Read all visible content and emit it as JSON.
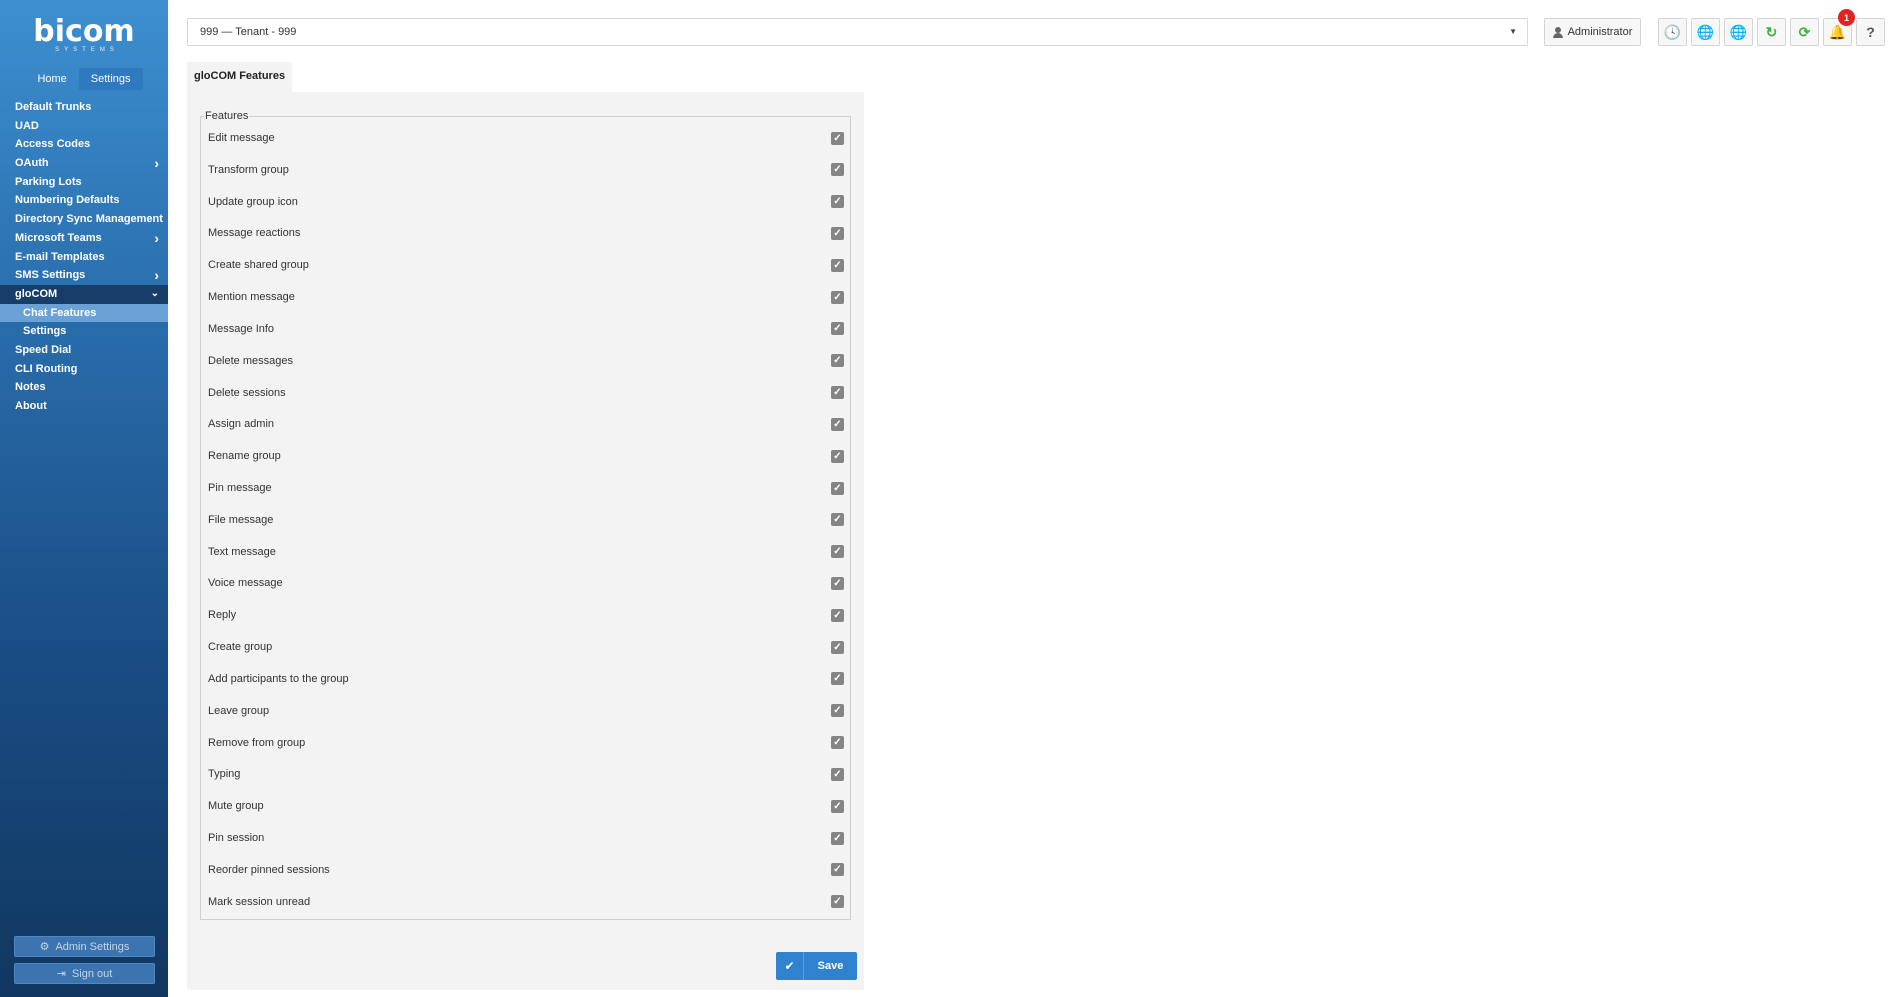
{
  "brand": {
    "name": "bicom",
    "tagline": "SYSTEMS"
  },
  "sidebar": {
    "tabs": [
      {
        "label": "Home",
        "active": false
      },
      {
        "label": "Settings",
        "active": true
      }
    ],
    "items": [
      {
        "label": "Default Trunks"
      },
      {
        "label": "UAD"
      },
      {
        "label": "Access Codes"
      },
      {
        "label": "OAuth",
        "chevron": "chevron-right-icon"
      },
      {
        "label": "Parking Lots"
      },
      {
        "label": "Numbering Defaults"
      },
      {
        "label": "Directory Sync Management"
      },
      {
        "label": "Microsoft Teams",
        "chevron": "chevron-right-icon"
      },
      {
        "label": "E-mail Templates"
      },
      {
        "label": "SMS Settings",
        "chevron": "chevron-right-icon"
      },
      {
        "label": "gloCOM",
        "chevron": "chevron-down-icon",
        "state": "open"
      },
      {
        "label": "Chat Features",
        "sub": true,
        "state": "active"
      },
      {
        "label": "Settings",
        "sub": true
      },
      {
        "label": "Speed Dial"
      },
      {
        "label": "CLI Routing"
      },
      {
        "label": "Notes"
      },
      {
        "label": "About"
      }
    ],
    "admin_settings_label": "Admin Settings",
    "sign_out_label": "Sign out"
  },
  "header": {
    "tenant_value": "999  —  Tenant - 999",
    "user_label": "Administrator",
    "icons": [
      "clock-icon",
      "globe-icon",
      "language-globe-icon",
      "reload-icon",
      "sync-icon",
      "bell-icon",
      "help-icon"
    ],
    "notification_count": "1"
  },
  "main": {
    "tab_label": "gloCOM Features",
    "fieldset_legend": "Features",
    "features": [
      {
        "label": "Edit message",
        "checked": true
      },
      {
        "label": "Transform group",
        "checked": true
      },
      {
        "label": "Update group icon",
        "checked": true
      },
      {
        "label": "Message reactions",
        "checked": true
      },
      {
        "label": "Create shared group",
        "checked": true
      },
      {
        "label": "Mention message",
        "checked": true
      },
      {
        "label": "Message Info",
        "checked": true
      },
      {
        "label": "Delete messages",
        "checked": true
      },
      {
        "label": "Delete sessions",
        "checked": true
      },
      {
        "label": "Assign admin",
        "checked": true
      },
      {
        "label": "Rename group",
        "checked": true
      },
      {
        "label": "Pin message",
        "checked": true
      },
      {
        "label": "File message",
        "checked": true
      },
      {
        "label": "Text message",
        "checked": true
      },
      {
        "label": "Voice message",
        "checked": true
      },
      {
        "label": "Reply",
        "checked": true
      },
      {
        "label": "Create group",
        "checked": true
      },
      {
        "label": "Add participants to the group",
        "checked": true
      },
      {
        "label": "Leave group",
        "checked": true
      },
      {
        "label": "Remove from group",
        "checked": true
      },
      {
        "label": "Typing",
        "checked": true
      },
      {
        "label": "Mute group",
        "checked": true
      },
      {
        "label": "Pin session",
        "checked": true
      },
      {
        "label": "Reorder pinned sessions",
        "checked": true
      },
      {
        "label": "Mark session unread",
        "checked": true
      }
    ],
    "save_label": "Save"
  },
  "colors": {
    "accent": "#2f82cd",
    "sidebar_active": "#6aa1d6",
    "sidebar_open": "#173e69",
    "badge": "#e02323",
    "refresh_green": "#3cb43c"
  }
}
